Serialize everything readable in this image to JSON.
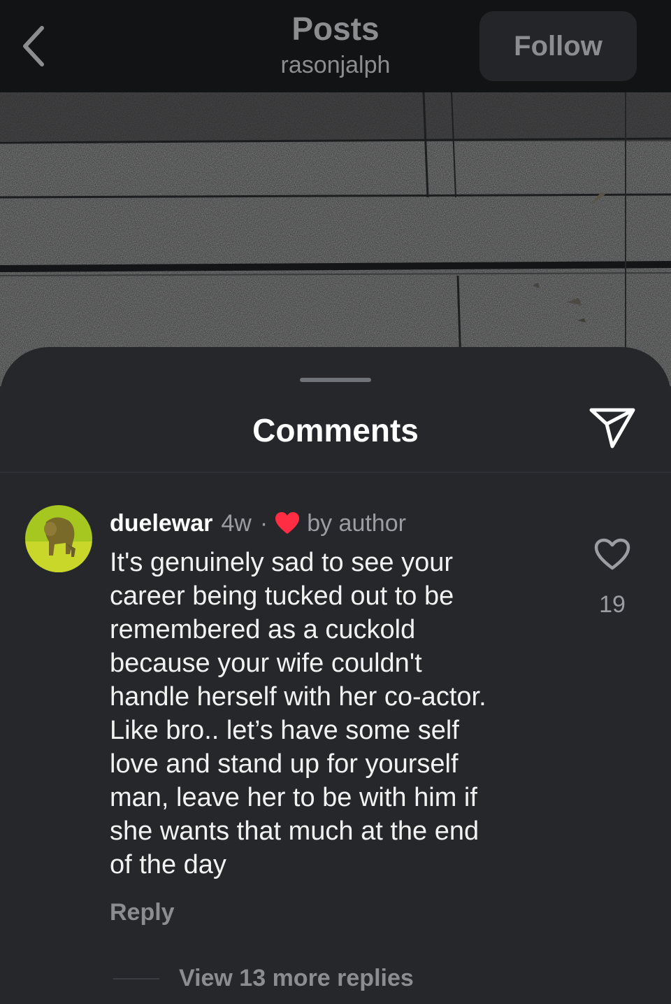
{
  "header": {
    "title": "Posts",
    "subtitle": "rasonjalph",
    "follow_label": "Follow"
  },
  "sheet": {
    "title": "Comments"
  },
  "comment": {
    "username": "duelewar",
    "timestamp": "4w",
    "separator": "·",
    "author_badge": "by author",
    "text": "It's genuinely sad to see your\ncareer being tucked out to be\nremembered as a cuckold\nbecause your wife couldn't\nhandle herself with her co-actor.\nLike bro.. let’s have some self\nlove and stand up for yourself\nman, leave her to be with him if\nshe wants that much at the end\nof the day",
    "reply_label": "Reply",
    "like_count": "19",
    "view_replies_label": "View 13 more replies"
  },
  "icons": {
    "back": "chevron-left-icon",
    "share": "paper-plane-icon",
    "like": "heart-outline-icon",
    "author_like": "heart-filled-icon"
  },
  "colors": {
    "topbar_bg": "#121314",
    "sheet_bg": "#25272b",
    "muted_text": "#8b8d90",
    "heart_red": "#ff2d43"
  }
}
